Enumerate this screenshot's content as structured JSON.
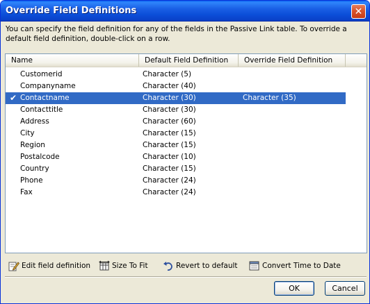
{
  "window": {
    "title": "Override Field Definitions",
    "close_glyph": "✕"
  },
  "description": "You can specify the field definition for any of the fields in the Passive Link table. To override a default field definition, double-click on a row.",
  "table": {
    "columns": [
      "Name",
      "Default Field Definition",
      "Override Field Definition"
    ],
    "rows": [
      {
        "name": "Customerid",
        "default": "Character (5)",
        "override": "",
        "checked": false,
        "selected": false
      },
      {
        "name": "Companyname",
        "default": "Character (40)",
        "override": "",
        "checked": false,
        "selected": false
      },
      {
        "name": "Contactname",
        "default": "Character (30)",
        "override": "Character (35)",
        "checked": true,
        "selected": true
      },
      {
        "name": "Contacttitle",
        "default": "Character (30)",
        "override": "",
        "checked": false,
        "selected": false
      },
      {
        "name": "Address",
        "default": "Character (60)",
        "override": "",
        "checked": false,
        "selected": false
      },
      {
        "name": "City",
        "default": "Character (15)",
        "override": "",
        "checked": false,
        "selected": false
      },
      {
        "name": "Region",
        "default": "Character (15)",
        "override": "",
        "checked": false,
        "selected": false
      },
      {
        "name": "Postalcode",
        "default": "Character (10)",
        "override": "",
        "checked": false,
        "selected": false
      },
      {
        "name": "Country",
        "default": "Character (15)",
        "override": "",
        "checked": false,
        "selected": false
      },
      {
        "name": "Phone",
        "default": "Character (24)",
        "override": "",
        "checked": false,
        "selected": false
      },
      {
        "name": "Fax",
        "default": "Character (24)",
        "override": "",
        "checked": false,
        "selected": false
      }
    ]
  },
  "actions": {
    "edit": {
      "label": "Edit field definition",
      "icon": "edit-icon"
    },
    "size": {
      "label": "Size To Fit",
      "icon": "size-to-fit-icon"
    },
    "revert": {
      "label": "Revert to default",
      "icon": "revert-icon"
    },
    "time": {
      "label": "Convert Time to Date",
      "icon": "convert-time-icon"
    }
  },
  "buttons": {
    "ok": "OK",
    "cancel": "Cancel"
  },
  "colors": {
    "selection": "#316ac5",
    "titlebar": "#0b4ed8",
    "dialog_bg": "#ece9d8"
  }
}
